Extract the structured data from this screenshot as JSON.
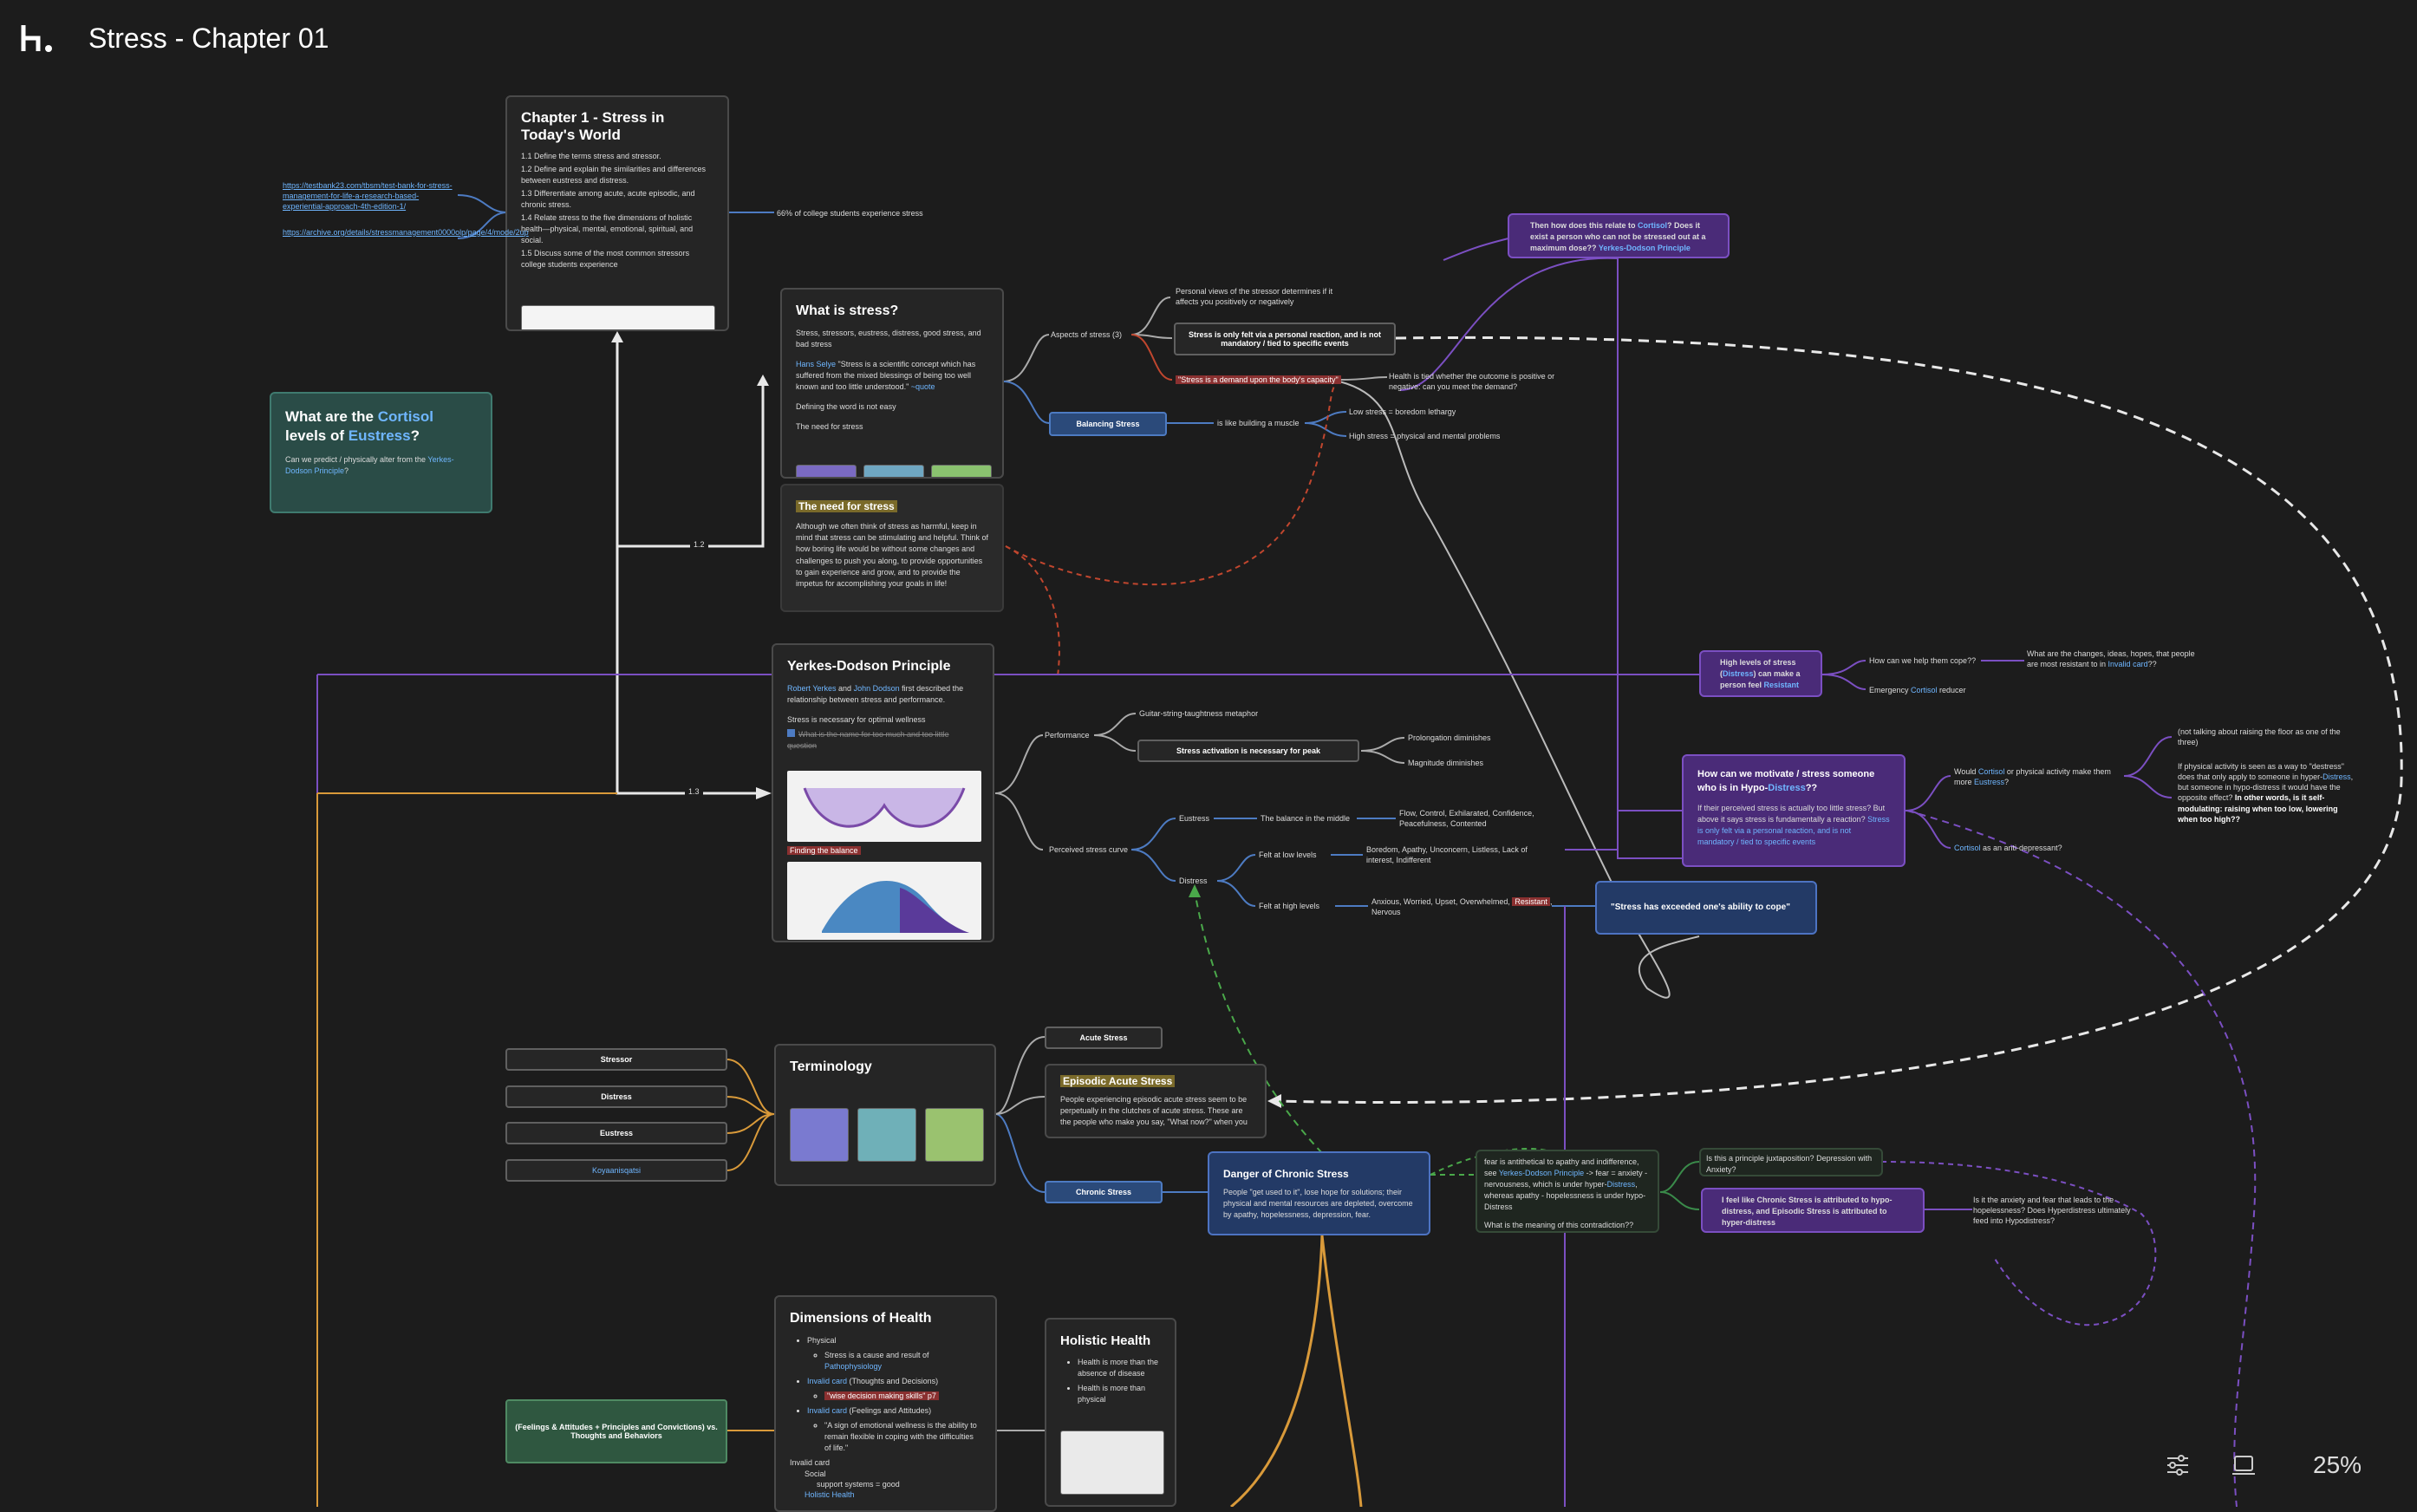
{
  "app": {
    "title": "Stress - Chapter 01",
    "logo": "logo-icon",
    "zoom": "25%"
  },
  "toolbar": {
    "settings_icon": "sliders-icon",
    "present_icon": "laptop-icon"
  },
  "chapter_card": {
    "title": "Chapter 1 - Stress in Today's World",
    "items": [
      "1.1 Define the terms stress and stressor.",
      "1.2 Define and explain the similarities and differences between eustress and distress.",
      "1.3 Differentiate among acute, acute episodic, and chronic stress.",
      "1.4 Relate stress to the five dimensions of holistic health—physical, mental, emotional, spiritual, and social.",
      "1.5 Discuss some of the most common stressors college students experience"
    ]
  },
  "links": {
    "testbank": "https://testbank23.com/tbsm/test-bank-for-stress-management-for-life-a-research-based-experiential-approach-4th-edition-1/",
    "archive": "https://archive.org/details/stressmanagement0000olp/page/4/mode/2up"
  },
  "college_stat": "66% of college students experience stress",
  "cortisol_card": {
    "t1": "What are the ",
    "t2": "Cortisol",
    "t3": " levels of ",
    "t4": "Eustress",
    "t5": "?",
    "body1": "Can we predict / physically alter from the ",
    "body2": "Yerkes-Dodson Principle",
    "body3": "?"
  },
  "what_is_stress": {
    "title": "What is stress?",
    "p1": "Stress, stressors, eustress, distress, good stress, and bad stress",
    "selye": "Hans Selye",
    "p2": " \"Stress is a scientific concept which has suffered from the mixed blessings of being too well known and too little understood.\" ",
    "quote": "~quote",
    "p3": "Defining the word is not easy",
    "p4": "The need for stress"
  },
  "need_for_stress": {
    "title": "The need for stress",
    "body": "Although we often think of stress as harmful, keep in mind that stress can be stimulating and helpful. Think of how boring life would be without some changes and challenges to push you along, to provide opportunities to gain experience and grow, and to provide the impetus for accomplishing your goals in life!"
  },
  "edge_labels": {
    "l12": "1.2",
    "l13": "1.3"
  },
  "aspects": {
    "label": "Aspects of stress (3)",
    "personal": "Personal views of the stressor determines if it affects you positively or negatively",
    "only_felt": "Stress is only felt via a personal reaction, and is not mandatory / tied to specific events",
    "demand": "\"Stress is a demand upon the body's capacity\"",
    "health": "Health is tied whether the outcome is positive or negative: can you meet the demand?"
  },
  "balancing": {
    "label": "Balancing Stress",
    "muscle": "is like building a muscle",
    "low": "Low stress = boredom lethargy",
    "high": "High stress = physical and mental problems"
  },
  "cortisol_q": {
    "a": "Then how does this relate to ",
    "b": "Cortisol",
    "c": "? Does it exist a person who can not be stressed out at a maximum dose?? ",
    "d": "Yerkes-Dodson Principle"
  },
  "yerkes": {
    "title": "Yerkes-Dodson Principle",
    "r1": "Robert Yerkes",
    "and": " and ",
    "r2": "John Dodson",
    "p1": " first described the relationship between stress and performance.",
    "p2": "Stress is necessary for optimal wellness",
    "todo": "What is the name for too much and too little question",
    "finding": "Finding the balance"
  },
  "performance": {
    "label": "Performance",
    "guitar": "Guitar-string-taughtness metaphor",
    "activation": "Stress activation is necessary for peak",
    "prolong": "Prolongation diminishes",
    "magnitude": "Magnitude diminishes"
  },
  "curve": {
    "label": "Perceived stress curve",
    "eustress": "Eustress",
    "balance": "The balance in the middle",
    "flow": "Flow, Control, Exhilarated, Confidence, Peacefulness, Contented",
    "distress": "Distress",
    "low": "Felt at low levels",
    "boredom": "Boredom, Apathy, Unconcern, Listless, Lack of interest, Indifferent",
    "high": "Felt at high levels",
    "anxious": "Anxious, Worried, Upset, Overwhelmed, ",
    "resistant": "Resistant",
    "nervous": ", Nervous"
  },
  "exceeded": "\"Stress has exceeded one's ability to cope\"",
  "high_levels": {
    "a": "High levels of stress (",
    "b": "Distress",
    "c": ") can make a person feel ",
    "d": "Resistant",
    "help": "How can we help them cope??",
    "changes_a": "What are the changes, ideas, hopes, that people are most resistant to in ",
    "changes_b": "Invalid card",
    "changes_c": "??",
    "emergency_a": "Emergency ",
    "emergency_b": "Cortisol",
    "emergency_c": " reducer"
  },
  "motivate": {
    "title_a": "How can we motivate / stress someone who is in Hypo-",
    "title_b": "Distress",
    "title_c": "??",
    "body_a": "If their perceived stress is actually too little stress? But above it says stress is fundamentally a reaction? ",
    "body_b": "Stress is only felt via a personal reaction, and is not mandatory / tied to specific events",
    "would_a": "Would ",
    "would_b": "Cortisol",
    "would_c": " or physical activity make them more ",
    "would_d": "Eustress",
    "would_e": "?",
    "floor": "(not talking about raising the floor as one of the three)",
    "hyper_a": "If physical activity is seen as a way to \"destress\" does that only apply to someone in hyper-",
    "hyper_b": "Distress",
    "hyper_c": ", but someone in hypo-distress it would have the opposite effect? ",
    "hyper_d": "In other words, is it self-modulating: raising when too low, lowering when too high??",
    "anti_a": "Cortisol",
    "anti_b": " as an anti-depressant?"
  },
  "terminology": {
    "title": "Terminology",
    "items": [
      "Stressor",
      "Distress",
      "Eustress",
      "Koyaanisqatsi"
    ]
  },
  "acute": {
    "label": "Acute Stress",
    "episodic_title": "Episodic Acute Stress",
    "episodic_body": "People experiencing episodic acute stress seem to be perpetually in the clutches of acute stress. These are the people who make you say, \"What now?\" when you",
    "chronic": "Chronic Stress"
  },
  "danger": {
    "title": "Danger of Chronic Stress",
    "body": "People \"get used to it\", lose hope for solutions; their physical and mental resources are depleted, overcome by apathy, hopelessness, depression, fear."
  },
  "fear": {
    "a": "fear is antithetical to apathy and indifference, see ",
    "b": "Yerkes-Dodson Principle",
    "c": " -> fear = anxiety - nervousness, which is under hyper-",
    "d": "Distress",
    "e": ", whereas apathy - hopelessness is under hypo-Distress",
    "q": "What is the meaning of this contradiction??"
  },
  "juxtaposition": "Is this a principle juxtaposition? Depression with Anxiety?",
  "chronic_feel": "I feel like Chronic Stress is attributed to hypo-distress, and Episodic Stress is attributed to hyper-distress",
  "is_it": "Is it the anxiety and fear that leads to the hopelessness? Does Hyperdistress ultimately feed into Hypodistress?",
  "dimensions": {
    "title": "Dimensions of Health",
    "physical": "Physical",
    "physical_sub_a": "Stress is a cause and result of ",
    "physical_sub_b": "Pathophysiology",
    "inv1": "Invalid card",
    "inv1_b": " (Thoughts and Decisions)",
    "wise": "\"wise decision making skills\" p7",
    "inv2": "Invalid card",
    "inv2_b": " (Feelings and Attitudes)",
    "sign": "\"A sign of emotional wellness is the ability to remain flexible in coping with the difficulties of life.\"",
    "inv3": "Invalid card",
    "social": "Social",
    "support": "support systems = good",
    "holistic": "Holistic Health"
  },
  "feelings_node": "(Feelings & Attitudes + Principles and Convictions) vs. Thoughts and Behaviors",
  "holistic": {
    "title": "Holistic Health",
    "i1": "Health is more than the absence of disease",
    "i2": "Health is more than physical"
  },
  "colors": {
    "purple": "#7b4fc2",
    "orange": "#d99a3a",
    "blue": "#4d7bc2",
    "white": "#e0e0e0",
    "red_dashed": "#c0462e",
    "green_dashed": "#4aa84a"
  }
}
